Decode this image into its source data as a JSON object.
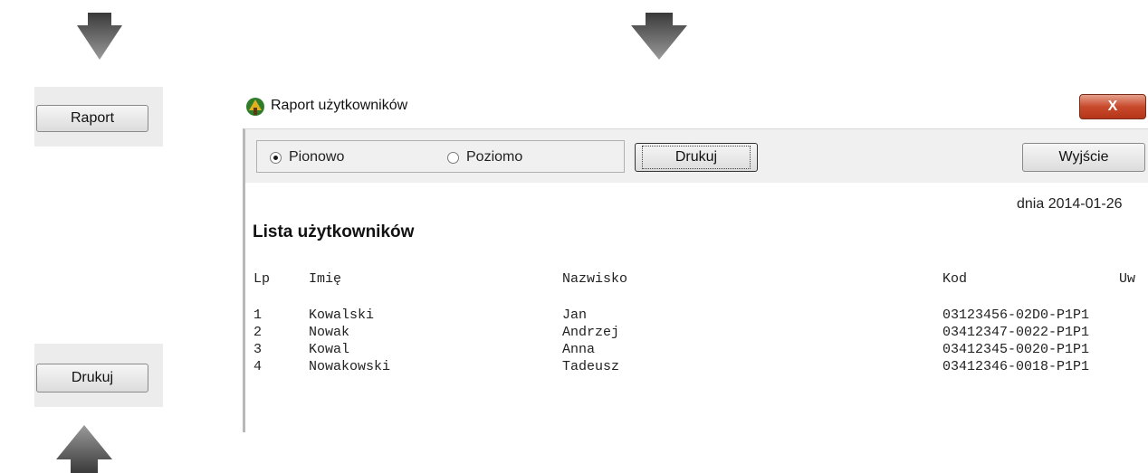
{
  "left_panel": {
    "raport_label": "Raport",
    "drukuj_label": "Drukuj"
  },
  "window": {
    "title": "Raport użytkowników",
    "close_label": "X",
    "toolbar": {
      "radio_pionowo": "Pionowo",
      "radio_poziomo": "Poziomo",
      "selected_orientation": "Pionowo",
      "print_label": "Drukuj",
      "exit_label": "Wyjście"
    },
    "report": {
      "date": "dnia 2014-01-26",
      "title": "Lista użytkowników",
      "columns": [
        "Lp",
        "Imię",
        "Nazwisko",
        "Kod",
        "Uw"
      ],
      "rows": [
        [
          "1",
          "Kowalski",
          "Jan",
          "03123456-02D0-P1P1"
        ],
        [
          "2",
          "Nowak",
          "Andrzej",
          "03412347-0022-P1P1"
        ],
        [
          "3",
          "Kowal",
          "Anna",
          "03412345-0020-P1P1"
        ],
        [
          "4",
          "Nowakowski",
          "Tadeusz",
          "03412346-0018-P1P1"
        ]
      ]
    }
  },
  "colors": {
    "arrow": "#555555",
    "close_button": "#c84a2c",
    "toolbar_bg": "#f0f0f0"
  }
}
